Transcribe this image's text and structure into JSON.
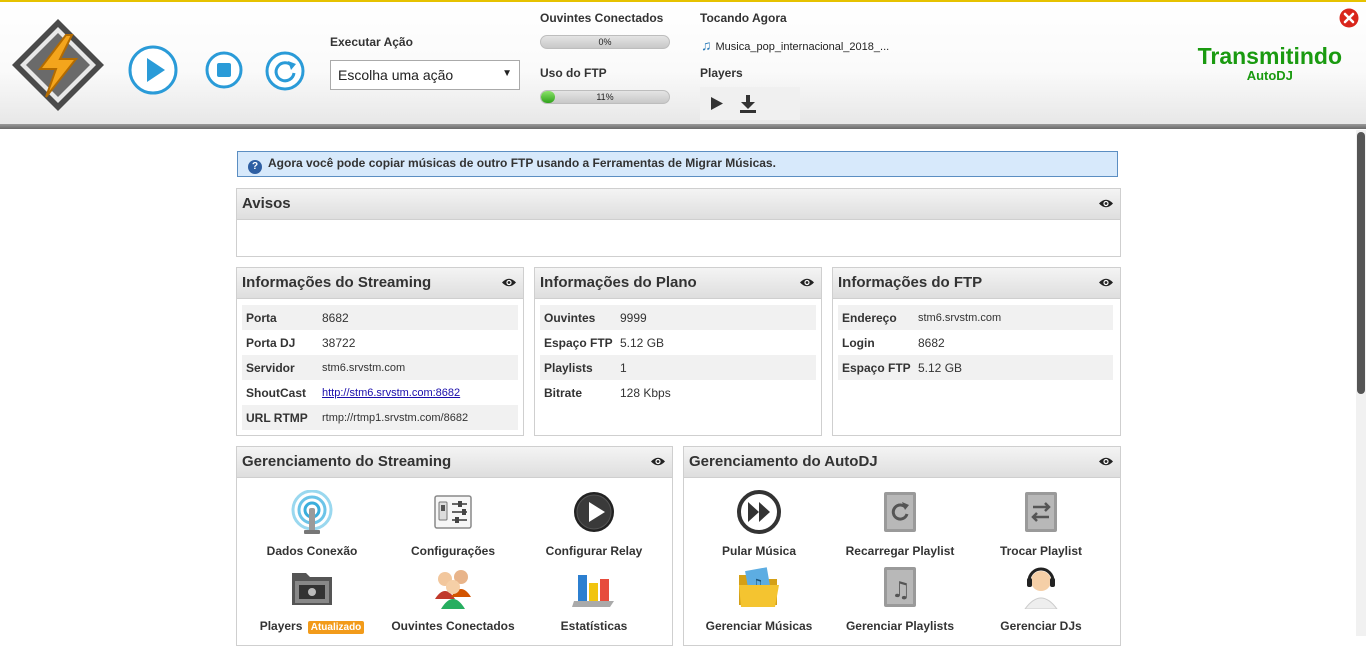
{
  "header": {
    "action": {
      "label": "Executar Ação",
      "selected": "Escolha uma ação"
    },
    "listeners": {
      "label": "Ouvintes Conectados",
      "percent_text": "0%",
      "percent": 0
    },
    "ftp_usage": {
      "label": "Uso do FTP",
      "percent_text": "11%",
      "percent": 11
    },
    "now_playing": {
      "label": "Tocando Agora",
      "track": "Musica_pop_internacional_2018_..."
    },
    "players": {
      "label": "Players"
    },
    "status": {
      "line1": "Transmitindo",
      "line2": "AutoDJ",
      "color": "#1a9a10"
    }
  },
  "banner": {
    "text": "Agora você pode copiar músicas de outro FTP usando a Ferramentas de Migrar Músicas."
  },
  "avisos": {
    "title": "Avisos"
  },
  "streaming_info": {
    "title": "Informações do Streaming",
    "rows": [
      {
        "key": "Porta",
        "value": "8682"
      },
      {
        "key": "Porta DJ",
        "value": "38722"
      },
      {
        "key": "Servidor",
        "value": "stm6.srvstm.com"
      },
      {
        "key": "ShoutCast",
        "value": "http://stm6.srvstm.com:8682"
      },
      {
        "key": "URL RTMP",
        "value": "rtmp://rtmp1.srvstm.com/8682"
      }
    ]
  },
  "plan_info": {
    "title": "Informações do Plano",
    "rows": [
      {
        "key": "Ouvintes",
        "value": "9999"
      },
      {
        "key": "Espaço FTP",
        "value": "5.12 GB"
      },
      {
        "key": "Playlists",
        "value": "1"
      },
      {
        "key": "Bitrate",
        "value": "128 Kbps"
      }
    ]
  },
  "ftp_info": {
    "title": "Informações do FTP",
    "rows": [
      {
        "key": "Endereço",
        "value": "stm6.srvstm.com"
      },
      {
        "key": "Login",
        "value": "8682"
      },
      {
        "key": "Espaço FTP",
        "value": "5.12 GB"
      }
    ]
  },
  "stream_mgmt": {
    "title": "Gerenciamento do Streaming",
    "tiles": [
      {
        "label": "Dados Conexão",
        "icon": "broadcast-antenna-icon"
      },
      {
        "label": "Configurações",
        "icon": "settings-sliders-icon"
      },
      {
        "label": "Configurar Relay",
        "icon": "relay-play-icon"
      },
      {
        "label": "Players",
        "icon": "media-folder-icon",
        "badge": "Atualizado"
      },
      {
        "label": "Ouvintes Conectados",
        "icon": "users-group-icon"
      },
      {
        "label": "Estatísticas",
        "icon": "bar-chart-icon"
      }
    ]
  },
  "autodj_mgmt": {
    "title": "Gerenciamento do AutoDJ",
    "tiles": [
      {
        "label": "Pular Música",
        "icon": "skip-forward-icon"
      },
      {
        "label": "Recarregar Playlist",
        "icon": "reload-playlist-icon"
      },
      {
        "label": "Trocar Playlist",
        "icon": "swap-playlist-icon"
      },
      {
        "label": "Gerenciar Músicas",
        "icon": "music-folder-icon"
      },
      {
        "label": "Gerenciar Playlists",
        "icon": "playlist-note-icon"
      },
      {
        "label": "Gerenciar DJs",
        "icon": "dj-headset-icon"
      }
    ]
  }
}
